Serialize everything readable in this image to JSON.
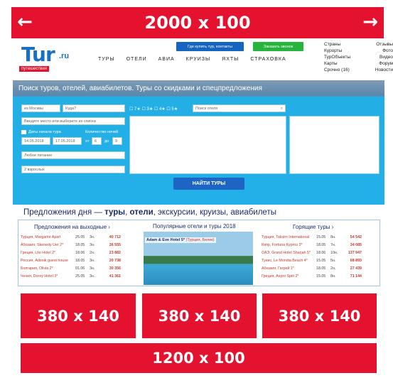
{
  "top_banner": {
    "label": "2000 x 100",
    "left_arrow": "←",
    "right_arrow": "→"
  },
  "header": {
    "logo": {
      "text": "Tur",
      "ru": ".ru",
      "sub": "путешествия"
    },
    "buttons": {
      "buy": "Где купить тур, контакты",
      "call": "Заказать звонок"
    },
    "nav": [
      "ТУРЫ",
      "ОТЕЛИ",
      "АВИА",
      "КРУИЗЫ",
      "ЯХТЫ",
      "СТРАХОВКА"
    ],
    "links_col1": [
      "Страны",
      "Курорты",
      "ТурОбъекты",
      "Карты",
      "Срочно (16)"
    ],
    "links_col2": [
      "Отзывы",
      "Фото",
      "Видео",
      "Форум",
      "Новости"
    ]
  },
  "search": {
    "title": "Поиск туров, отелей, авиабилетов. Туры со скидками и спецпредложения",
    "from": "из Москвы",
    "where": "Куда?",
    "place_placeholder": "Введите место или выберите из списка",
    "dates_label": "Даты начала тура",
    "date_from": "14.05.2018",
    "date_to": "17.05.2018",
    "nights_label": "Количество ночей",
    "nights_from_label": "от",
    "nights_from": "6",
    "nights_to_label": "до",
    "nights_to": "9",
    "meal": "Любое питание",
    "adults": "2 взрослых",
    "stars": [
      "7",
      "3",
      "4",
      "5"
    ],
    "hotel_search_placeholder": "Поиск отеля",
    "find_button": "НАЙТИ ТУРЫ"
  },
  "offers": {
    "title_prefix": "Предложения дня — ",
    "title_bold1": "туры",
    "title_sep1": ", ",
    "title_bold2": "отели",
    "title_rest": ", экскурсии, круизы, авиабилеты",
    "weekend": {
      "title": "Предложения на выходные  ›",
      "rows": [
        {
          "name": "Турция, Margarite Apart",
          "date": "25.05",
          "nights": "3н.",
          "price": "40 712"
        },
        {
          "name": "Абхазия, Skenedy Uer 2*",
          "date": "18.05",
          "nights": "3н.",
          "price": "26 555"
        },
        {
          "name": "Греция, Lito Hotel 2*",
          "date": "18.06",
          "nights": "2н.",
          "price": "23 882"
        },
        {
          "name": "Россия, Adonik guest house",
          "date": "18.05",
          "nights": "3н.",
          "price": "20 738"
        },
        {
          "name": "Болгария, Olivia 2*",
          "date": "01.06",
          "nights": "3н.",
          "price": "30 356"
        },
        {
          "name": "Чехия, Dorey Hotel 3*",
          "date": "25.05",
          "nights": "3н.",
          "price": "41 361"
        }
      ]
    },
    "popular": {
      "title": "Популярные отели и туры 2018",
      "hotel_name": "Adam & Eve Hotel 5*",
      "hotel_place": "(Турция, Белек)"
    },
    "hot": {
      "title": "Горящие туры  ›",
      "rows": [
        {
          "name": "Турция, Taksim International",
          "date": "15.05",
          "nights": "8н.",
          "price": "54 542"
        },
        {
          "name": "Кипр, Fortuna Kypros 3*",
          "date": "18.05",
          "nights": "7н.",
          "price": "34 085"
        },
        {
          "name": "ОАЭ, Grand Hotel Sharjah 5*",
          "date": "18.06",
          "nights": "10н.",
          "price": "137 947"
        },
        {
          "name": "Тунис, Le Mondia Beach 4*",
          "date": "15.05",
          "nights": "5н.",
          "price": "68 893"
        },
        {
          "name": "Абхазия, Гагрей 1*",
          "date": "18.05",
          "nights": "2н.",
          "price": "27 439"
        },
        {
          "name": "Греция, Aspro Spiti 2*",
          "date": "15.05",
          "nights": "8н.",
          "price": "71 144"
        }
      ]
    }
  },
  "ads": {
    "box1": "380 x 140",
    "box2": "380 x 140",
    "box3": "380 x 140",
    "bottom": "1200 x 100"
  },
  "colors": {
    "ad_red": "#e4122e",
    "search_blue": "#23b0e8",
    "button_blue": "#1d64c4",
    "button_green": "#27b43c"
  }
}
